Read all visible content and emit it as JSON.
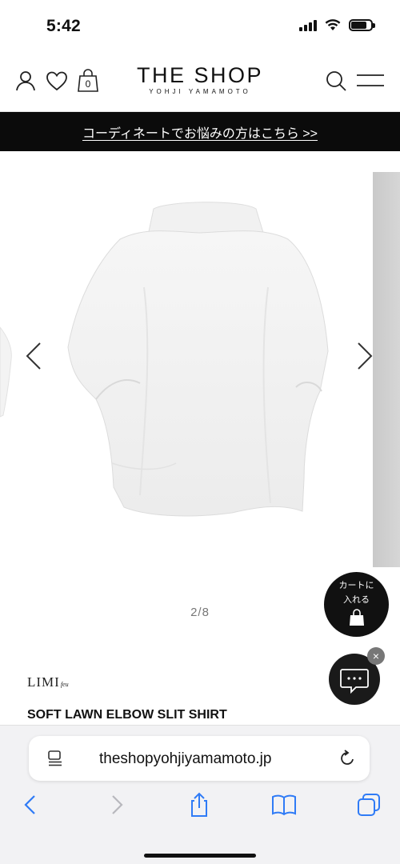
{
  "status_bar": {
    "time": "5:42",
    "icons": [
      "signal-icon",
      "wifi-icon",
      "battery-icon"
    ]
  },
  "header": {
    "logo_main": "THE SHOP",
    "logo_sub": "YOHJI YAMAMOTO",
    "cart_count": "0",
    "icons": [
      "user-icon",
      "heart-icon",
      "shopping-bag-icon",
      "search-icon",
      "menu-icon"
    ]
  },
  "banner": {
    "text": "コーディネートでお悩みの方はこちら >>"
  },
  "gallery": {
    "pager": "2/8",
    "prev_icon": "chevron-left-icon",
    "next_icon": "chevron-right-icon"
  },
  "floating": {
    "cart_line1": "カートに",
    "cart_line2": "入れる",
    "chat_close": "×"
  },
  "product": {
    "brand": "LIMI",
    "brand_suffix": "feu",
    "name": "SOFT LAWN ELBOW SLIT SHIRT"
  },
  "safari": {
    "url": "theshopyohjiyamamoto.jp",
    "tools": [
      "back-icon",
      "forward-icon",
      "share-icon",
      "bookmarks-icon",
      "tabs-icon"
    ]
  },
  "colors": {
    "banner_bg": "#0b0b0b",
    "accent_blue": "#2f7bf6",
    "fab_bg": "#111111"
  }
}
